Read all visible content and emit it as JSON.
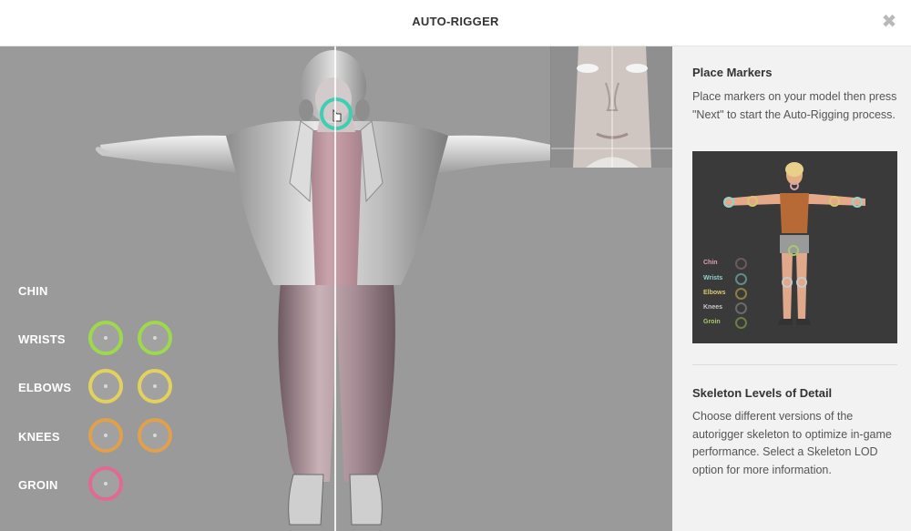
{
  "header": {
    "title": "AUTO-RIGGER",
    "close_icon": "close-icon"
  },
  "markers": [
    {
      "label": "CHIN",
      "color": "#4fd6c0",
      "count": 0
    },
    {
      "label": "WRISTS",
      "color": "#9ed84b",
      "count": 2
    },
    {
      "label": "ELBOWS",
      "color": "#e2d15c",
      "count": 2
    },
    {
      "label": "KNEES",
      "color": "#e0a04c",
      "count": 2
    },
    {
      "label": "GROIN",
      "color": "#e06a92",
      "count": 1
    }
  ],
  "sidebar": {
    "place_markers": {
      "title": "Place Markers",
      "description": "Place markers on your model then press \"Next\" to start the Auto-Rigging process."
    },
    "guide": {
      "labels": [
        "Chin",
        "Wrists",
        "Elbows",
        "Knees",
        "Groin"
      ],
      "label_colors": [
        "#d9a3b3",
        "#8fd4d0",
        "#d8c86a",
        "#c8c8c8",
        "#a7c96a"
      ]
    },
    "skeleton_lod": {
      "title": "Skeleton Levels of Detail",
      "description": "Choose different versions of the autorigger skeleton to optimize in-game performance. Select a Skeleton LOD option for more information."
    }
  }
}
